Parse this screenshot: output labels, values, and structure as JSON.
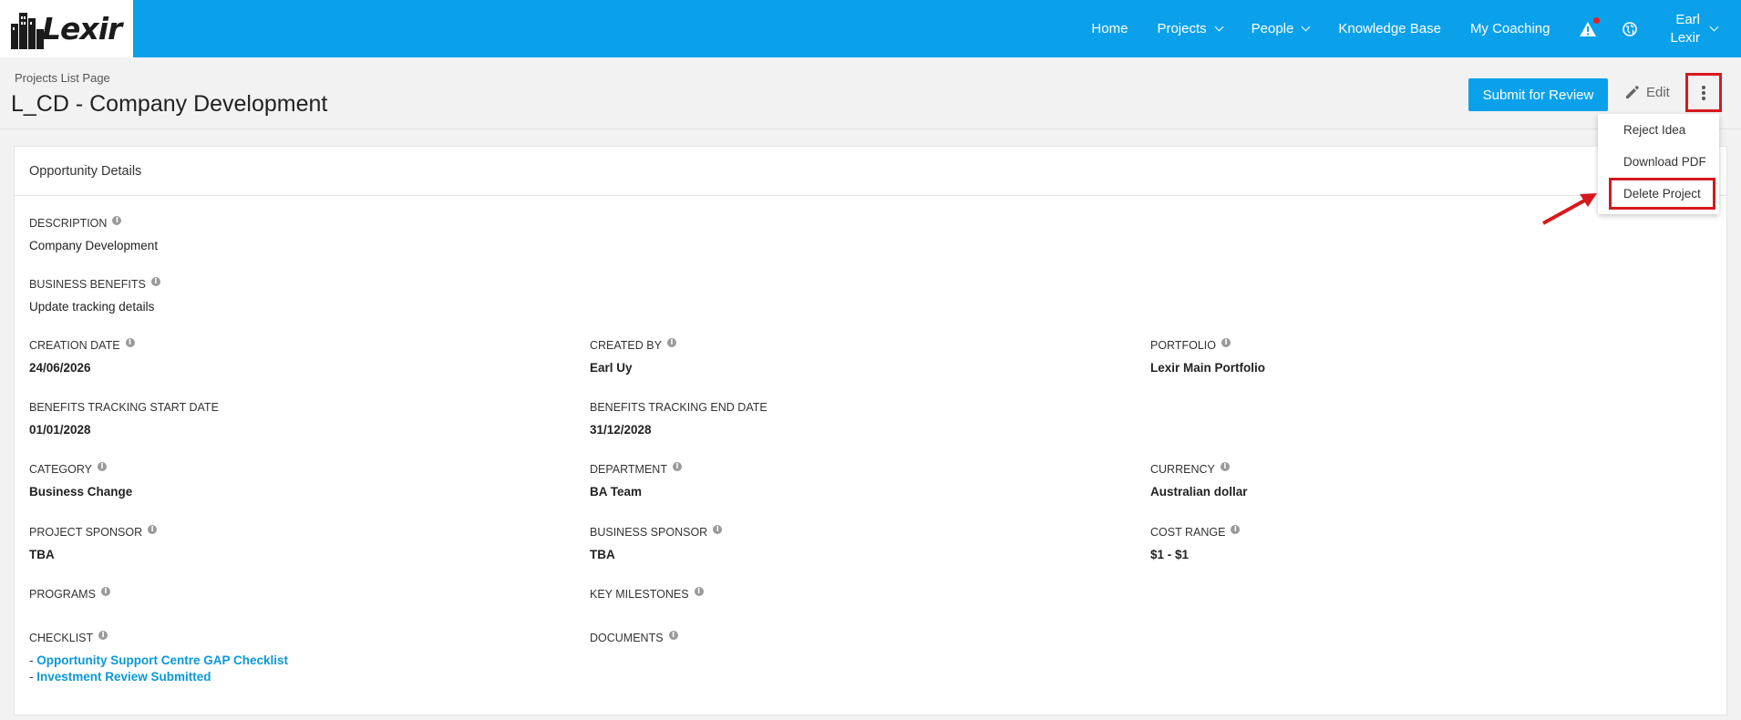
{
  "brand": {
    "logo_text": "Lexir"
  },
  "nav": {
    "items": [
      {
        "label": "Home",
        "dropdown": false
      },
      {
        "label": "Projects",
        "dropdown": true
      },
      {
        "label": "People",
        "dropdown": true
      },
      {
        "label": "Knowledge Base",
        "dropdown": false
      },
      {
        "label": "My Coaching",
        "dropdown": false
      }
    ],
    "user": {
      "first_name": "Earl",
      "last_name": "Lexir"
    },
    "icons": [
      "warning-icon",
      "globe-icon"
    ]
  },
  "header": {
    "breadcrumb": "Projects List Page",
    "title": "L_CD - Company Development",
    "submit_label": "Submit for Review",
    "edit_label": "Edit"
  },
  "actions_menu": {
    "items": [
      "Reject Idea",
      "Download PDF",
      "Delete Project"
    ],
    "highlighted": "Delete Project"
  },
  "card": {
    "title": "Opportunity Details",
    "description": {
      "label": "DESCRIPTION",
      "value": "Company Development"
    },
    "business_benefits": {
      "label": "BUSINESS BENEFITS",
      "value": "Update tracking details"
    },
    "creation_date": {
      "label": "CREATION DATE",
      "value": "24/06/2026"
    },
    "created_by": {
      "label": "CREATED BY",
      "value": "Earl Uy"
    },
    "portfolio": {
      "label": "PORTFOLIO",
      "value": "Lexir Main Portfolio"
    },
    "bt_start": {
      "label": "BENEFITS TRACKING START DATE",
      "value": "01/01/2028"
    },
    "bt_end": {
      "label": "BENEFITS TRACKING END DATE",
      "value": "31/12/2028"
    },
    "category": {
      "label": "CATEGORY",
      "value": "Business Change"
    },
    "department": {
      "label": "DEPARTMENT",
      "value": "BA Team"
    },
    "currency": {
      "label": "CURRENCY",
      "value": "Australian dollar"
    },
    "project_sponsor": {
      "label": "PROJECT SPONSOR",
      "value": "TBA"
    },
    "business_sponsor": {
      "label": "BUSINESS SPONSOR",
      "value": "TBA"
    },
    "cost_range": {
      "label": "COST RANGE",
      "value": "$1 - $1"
    },
    "programs": {
      "label": "PROGRAMS"
    },
    "key_milestones": {
      "label": "KEY MILESTONES"
    },
    "checklist": {
      "label": "CHECKLIST",
      "items": [
        "Opportunity Support Centre GAP Checklist",
        "Investment Review Submitted"
      ]
    },
    "documents": {
      "label": "DOCUMENTS"
    }
  },
  "colors": {
    "brand_blue": "#0aa1ea",
    "annotation_red": "#d7191f",
    "link_blue": "#0a98d9"
  }
}
